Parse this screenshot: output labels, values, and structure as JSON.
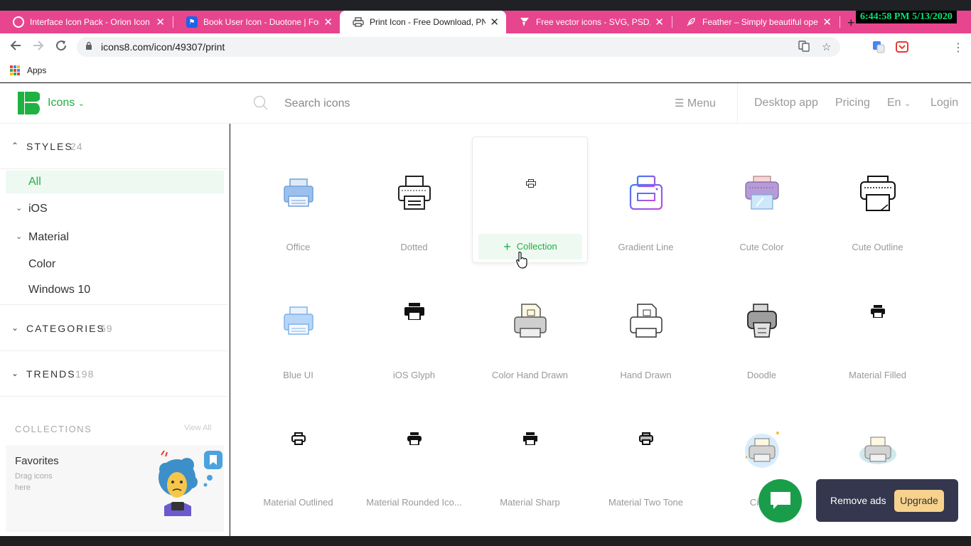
{
  "browser": {
    "tabs": [
      {
        "title": "Interface Icon Pack - Orion Icon",
        "favicon": "orion-icon"
      },
      {
        "title": "Book User Icon - Duotone | Font",
        "favicon": "flag-icon"
      },
      {
        "title": "Print Icon - Free Download, PNG",
        "favicon": "printer-icon",
        "active": true
      },
      {
        "title": "Free vector icons - SVG, PSD, PI",
        "favicon": "flaticon-icon"
      },
      {
        "title": "Feather – Simply beautiful open",
        "favicon": "feather-icon"
      }
    ],
    "clock": "6:44:58 PM 5/13/2020",
    "url": "icons8.com/icon/49307/print",
    "bookmarks": {
      "apps_label": "Apps"
    }
  },
  "header": {
    "brand": "Icons",
    "search_placeholder": "Search icons",
    "menu": "Menu",
    "desktop_app": "Desktop app",
    "pricing": "Pricing",
    "lang": "En",
    "login": "Login"
  },
  "sidebar": {
    "styles": {
      "label": "STYLES",
      "count": "24"
    },
    "style_items": [
      {
        "label": "All",
        "active": true
      },
      {
        "label": "iOS",
        "expandable": true
      },
      {
        "label": "Material",
        "expandable": true
      },
      {
        "label": "Color"
      },
      {
        "label": "Windows 10"
      }
    ],
    "categories": {
      "label": "CATEGORIES",
      "count": "59"
    },
    "trends": {
      "label": "TRENDS",
      "count": "198"
    },
    "collections": {
      "label": "COLLECTIONS",
      "view_all": "View All"
    },
    "favorites": {
      "title": "Favorites",
      "subtitle": "Drag icons here"
    }
  },
  "icons": [
    {
      "name": "Office"
    },
    {
      "name": "Dotted"
    },
    {
      "name": "",
      "hover": true,
      "button": "Collection"
    },
    {
      "name": "Gradient Line"
    },
    {
      "name": "Cute Color"
    },
    {
      "name": "Cute Outline"
    },
    {
      "name": "Blue UI"
    },
    {
      "name": "iOS Glyph"
    },
    {
      "name": "Color Hand Drawn"
    },
    {
      "name": "Hand Drawn"
    },
    {
      "name": "Doodle"
    },
    {
      "name": "Material Filled"
    },
    {
      "name": "Material Outlined"
    },
    {
      "name": "Material Rounded Ico..."
    },
    {
      "name": "Material Sharp"
    },
    {
      "name": "Material Two Tone"
    },
    {
      "name": "Circle"
    },
    {
      "name": ""
    }
  ],
  "ads": {
    "remove_ads": "Remove ads",
    "upgrade": "Upgrade"
  },
  "colors": {
    "accent": "#1fb141",
    "tab_strip": "#e8458f",
    "ads_bg": "#34374d",
    "upgrade_bg": "#f6d28d",
    "chat_bg": "#1a9d4a"
  }
}
